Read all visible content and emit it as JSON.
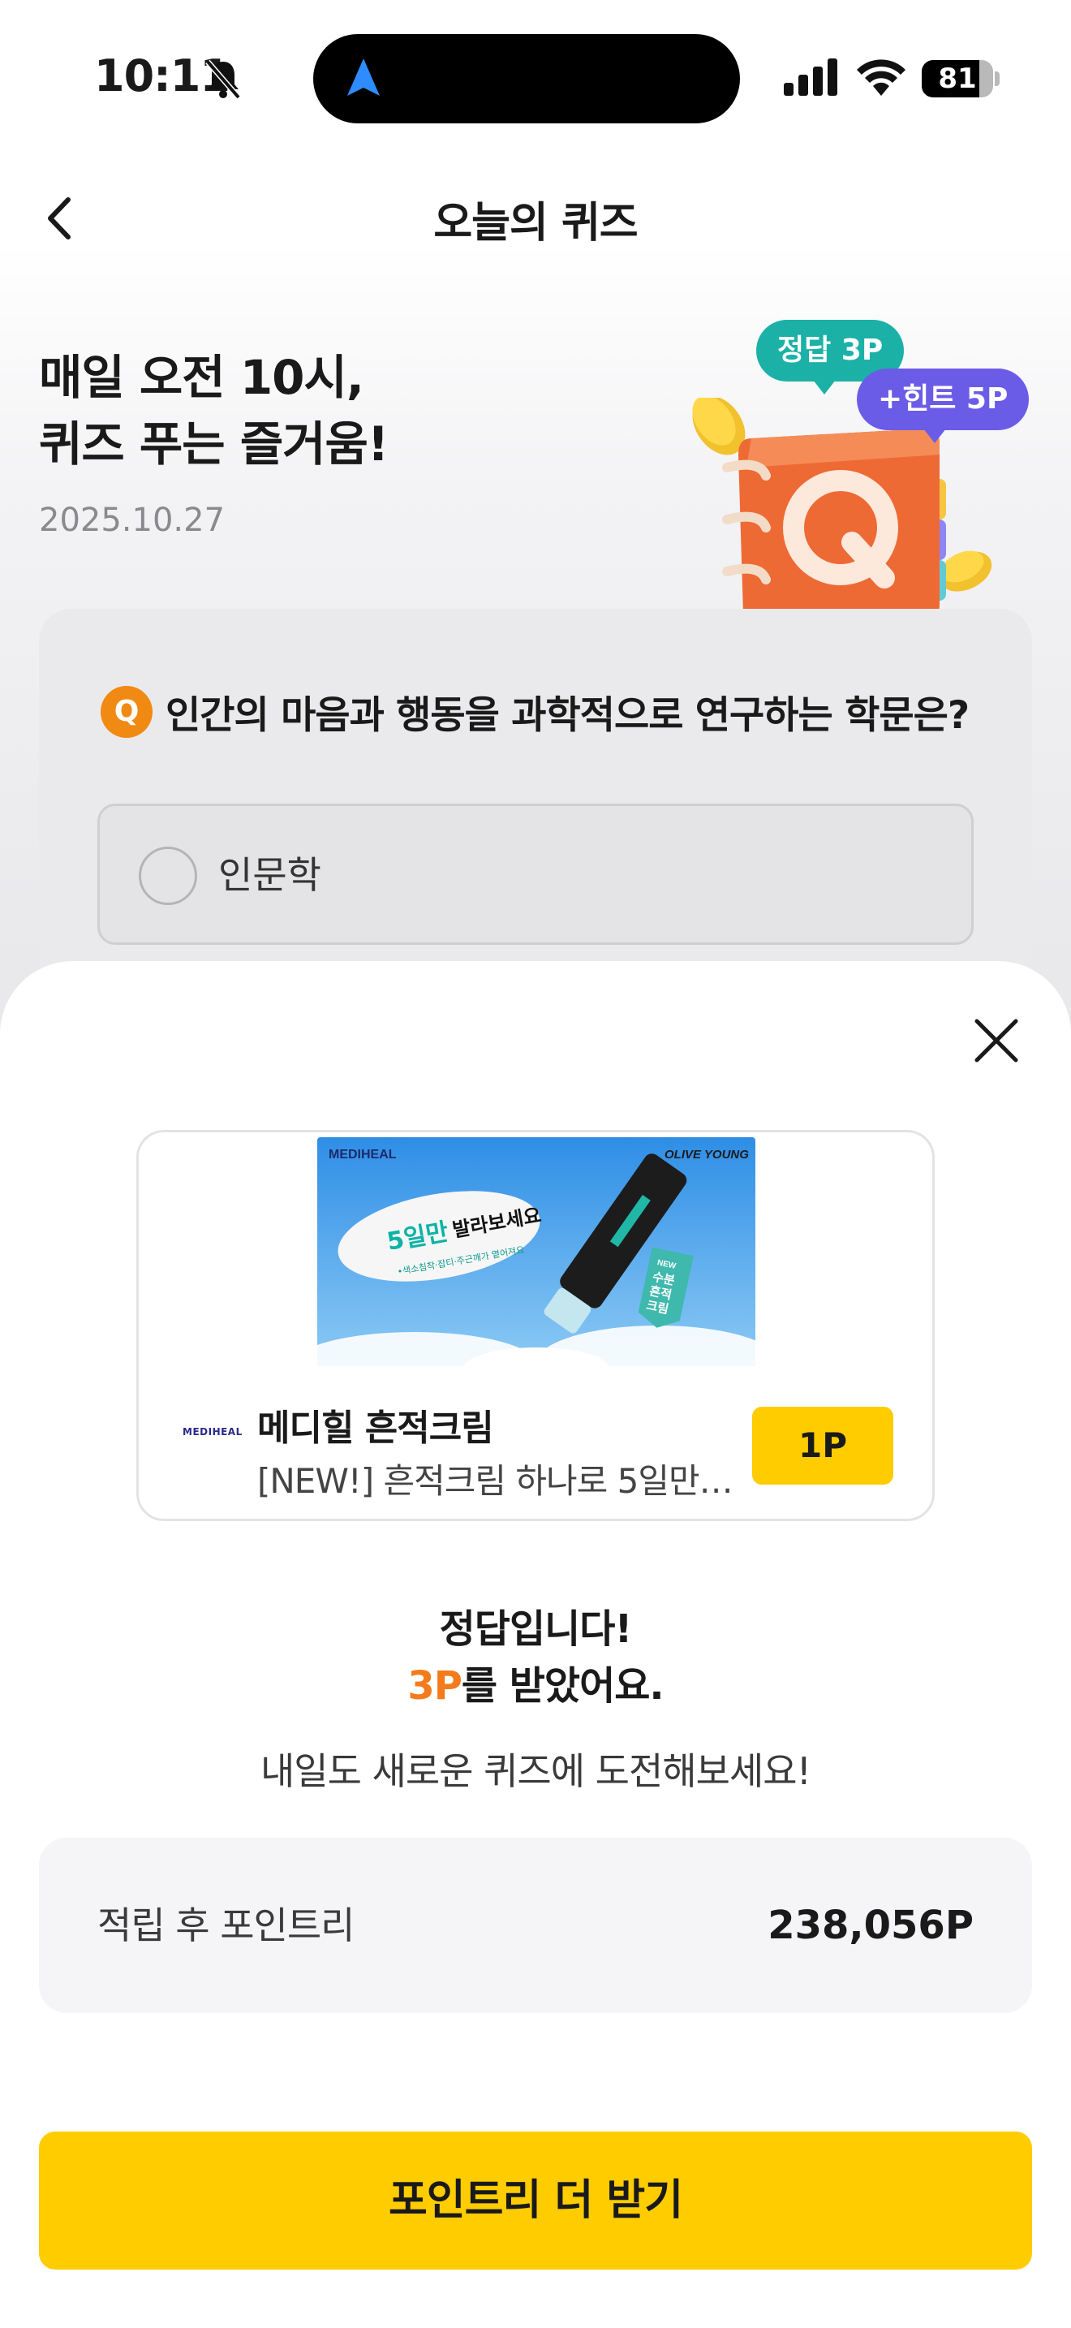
{
  "status_bar": {
    "time": "10:11",
    "battery": "81",
    "battery_level_percent": 81
  },
  "header": {
    "title": "오늘의 퀴즈",
    "back_icon": "chevron-left-icon"
  },
  "hero": {
    "title_line1": "매일 오전 10시,",
    "title_line2": "퀴즈 푸는 즐거움!",
    "date": "2025.10.27",
    "answer_bubble": "정답 3P",
    "hint_bubble": "+힌트 5P"
  },
  "quiz": {
    "badge": "Q",
    "question": "인간의 마음과 행동을 과학적으로 연구하는 학문은?",
    "options": [
      "인문학"
    ]
  },
  "ad": {
    "banner_brand_left": "MEDIHEAL",
    "banner_brand_right": "OLIVE YOUNG",
    "banner_headline_highlight": "5일만",
    "banner_headline_rest": "발라보세요",
    "banner_sub": "•색소침착·잡티·주근깨가 옅어져요",
    "banner_tag": "NEW 수분 흔적 크림",
    "banner_tag_new": "NEW",
    "banner_tag_l1": "수분",
    "banner_tag_l2": "흔적",
    "banner_tag_l3": "크림",
    "logo": "MEDIHEAL",
    "title": "메디힐 흔적크림",
    "description": "[NEW!] 흔적크림 하나로 5일만에...",
    "point_button": "1P"
  },
  "result": {
    "line1": "정답입니다!",
    "points": "3P",
    "line2_rest": "를 받았어요.",
    "sub": "내일도 새로운 퀴즈에 도전해보세요!"
  },
  "balance": {
    "label": "적립 후 포인트리",
    "value": "238,056P"
  },
  "cta": {
    "label": "포인트리 더 받기"
  },
  "colors": {
    "accent_yellow": "#ffcc00",
    "points_orange": "#f47b1c",
    "answer_teal": "#1bb1a6",
    "hint_purple": "#6b5ce7",
    "quiz_badge_orange": "#f08a12"
  }
}
